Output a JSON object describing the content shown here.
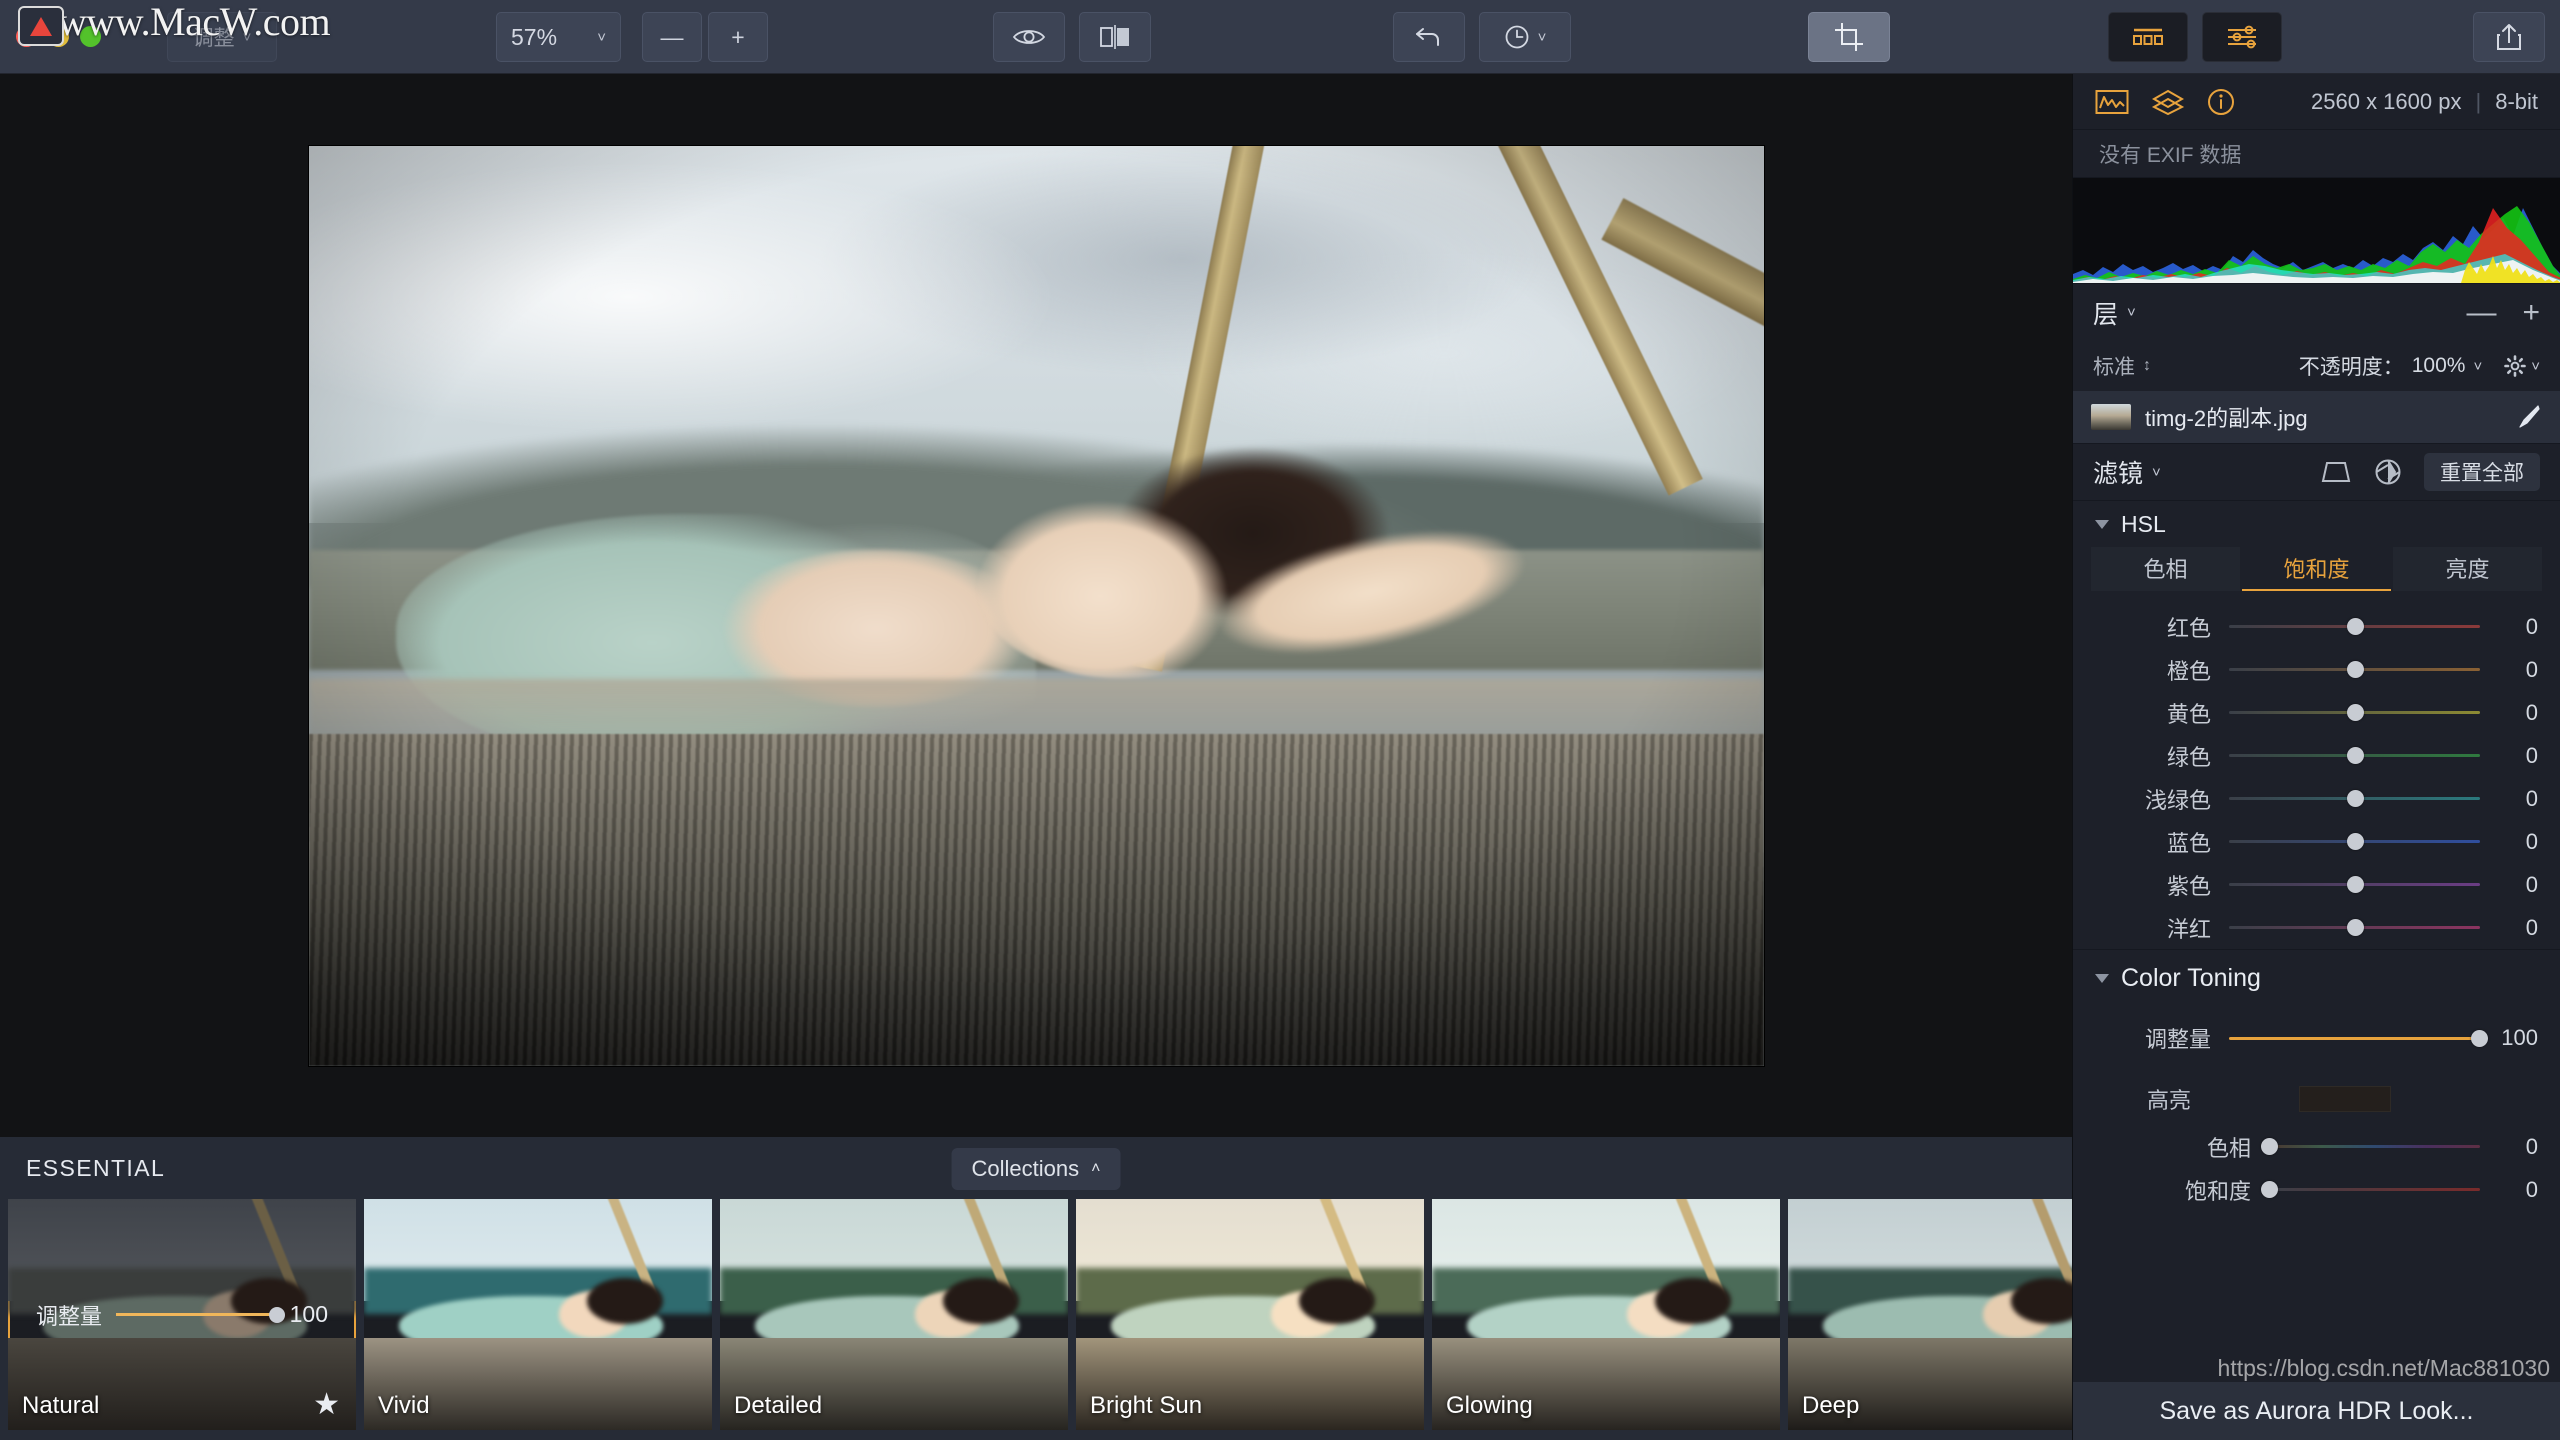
{
  "titlebar": {
    "zoom_level": "57%",
    "buttons": {
      "eye": "eye-icon",
      "compare": "compare-split-icon",
      "undo": "undo-icon",
      "history": "history-clock-icon",
      "crop": "crop-icon",
      "looks": "looks-grid-icon",
      "adjust": "adjust-sliders-icon",
      "share": "share-icon",
      "zoom_out": "—",
      "zoom_in": "+"
    },
    "overlay_button_label": "调整"
  },
  "watermark": {
    "site": "www.MacW.com",
    "url": "https://blog.csdn.net/Mac881030"
  },
  "right_panel": {
    "top": {
      "histogram_icon": "histogram-icon",
      "layers_icon": "layers-icon",
      "info_icon": "info-icon",
      "dimensions": "2560 x 1600 px",
      "separator": "|",
      "bit_depth": "8-bit"
    },
    "exif_note": "没有 EXIF 数据",
    "layers": {
      "title": "层",
      "remove_label": "—",
      "add_label": "+",
      "blend_mode": "标准",
      "opacity_label": "不透明度：",
      "opacity_value": "100%",
      "items": [
        {
          "name": "timg-2的副本.jpg"
        }
      ]
    },
    "filters": {
      "title": "滤镜",
      "mask_icon": "mask-icon",
      "aperture_icon": "aperture-icon",
      "reset_all": "重置全部"
    },
    "hsl": {
      "group_title": "HSL",
      "tabs": [
        {
          "label": "色相",
          "active": false
        },
        {
          "label": "饱和度",
          "active": true
        },
        {
          "label": "亮度",
          "active": false
        }
      ],
      "sliders": [
        {
          "label": "红色",
          "value": "0",
          "pos": 50,
          "color": "#8c3a3a"
        },
        {
          "label": "橙色",
          "value": "0",
          "pos": 50,
          "color": "#8a6134"
        },
        {
          "label": "黄色",
          "value": "0",
          "pos": 50,
          "color": "#8d8b33"
        },
        {
          "label": "绿色",
          "value": "0",
          "pos": 50,
          "color": "#2f7a3f"
        },
        {
          "label": "浅绿色",
          "value": "0",
          "pos": 50,
          "color": "#2b7a7e"
        },
        {
          "label": "蓝色",
          "value": "0",
          "pos": 50,
          "color": "#2f4e9e"
        },
        {
          "label": "紫色",
          "value": "0",
          "pos": 50,
          "color": "#6b3d84"
        },
        {
          "label": "洋红",
          "value": "0",
          "pos": 50,
          "color": "#8c3460"
        }
      ]
    },
    "color_toning": {
      "group_title": "Color Toning",
      "amount": {
        "label": "调整量",
        "value": "100",
        "pos": 100
      },
      "highlights": {
        "label": "高亮",
        "swatch_color": "#241f1c",
        "sliders": [
          {
            "label": "色相",
            "value": "0",
            "pos": 0,
            "color": "rainbow"
          },
          {
            "label": "饱和度",
            "value": "0",
            "pos": 0,
            "color": "#7a2b2b"
          }
        ]
      }
    },
    "save_look_button": "Save as Aurora HDR Look..."
  },
  "presets_bar": {
    "category": "ESSENTIAL",
    "collections_button": "Collections",
    "items": [
      {
        "name": "Natural",
        "selected": true,
        "starred": true,
        "amount_label": "调整量",
        "amount_value": "100",
        "sky": "linear-gradient(180deg,#3f434a,#53565b)",
        "mid": "#3a3d3c",
        "base": "linear-gradient(180deg,#4a463f,#221f1c)",
        "fig": "#5d6a63",
        "skin": "#8a7a6b",
        "bam": "#6b5f45"
      },
      {
        "name": "Vivid",
        "selected": false,
        "starred": false,
        "sky": "linear-gradient(180deg,#cfe0e6,#dfeaee)",
        "mid": "#2f6b6f",
        "base": "linear-gradient(180deg,#9c9383,#2d2a25)",
        "fig": "#9fd0c5",
        "skin": "#f2d8bd",
        "bam": "#c9b383"
      },
      {
        "name": "Detailed",
        "selected": false,
        "starred": false,
        "sky": "linear-gradient(180deg,#c9d8d6,#d6e2df)",
        "mid": "#3b5f4a",
        "base": "linear-gradient(180deg,#8a8676,#262420)",
        "fig": "#a8c7bb",
        "skin": "#edd5b9",
        "bam": "#bfa977"
      },
      {
        "name": "Bright Sun",
        "selected": false,
        "starred": false,
        "sky": "linear-gradient(180deg,#e4ded0,#efe8d6)",
        "mid": "#5d6b4a",
        "base": "linear-gradient(180deg,#a2957c,#2b2620)",
        "fig": "#bfd3bf",
        "skin": "#f6e0c2",
        "bam": "#d4bb83"
      },
      {
        "name": "Glowing",
        "selected": false,
        "starred": false,
        "sky": "linear-gradient(180deg,#dbe6e4,#e7efec)",
        "mid": "#4b6b58",
        "base": "linear-gradient(180deg,#98907e,#272420)",
        "fig": "#b3d2c6",
        "skin": "#f4ddc2",
        "bam": "#ccb37e"
      },
      {
        "name": "Deep",
        "selected": false,
        "starred": false,
        "sky": "linear-gradient(180deg,#c3cfd2,#d2dcdd)",
        "mid": "#36524a",
        "base": "linear-gradient(180deg,#7e7868,#1e1c19)",
        "fig": "#9cbcb0",
        "skin": "#e6cdb0",
        "bam": "#b49c6d"
      }
    ]
  },
  "colors": {
    "accent": "#e8a33d",
    "titlebar_bg": "#343a49",
    "panel_bg": "#1d2029",
    "canvas_bg": "#121315",
    "presets_bg": "#262b36"
  }
}
